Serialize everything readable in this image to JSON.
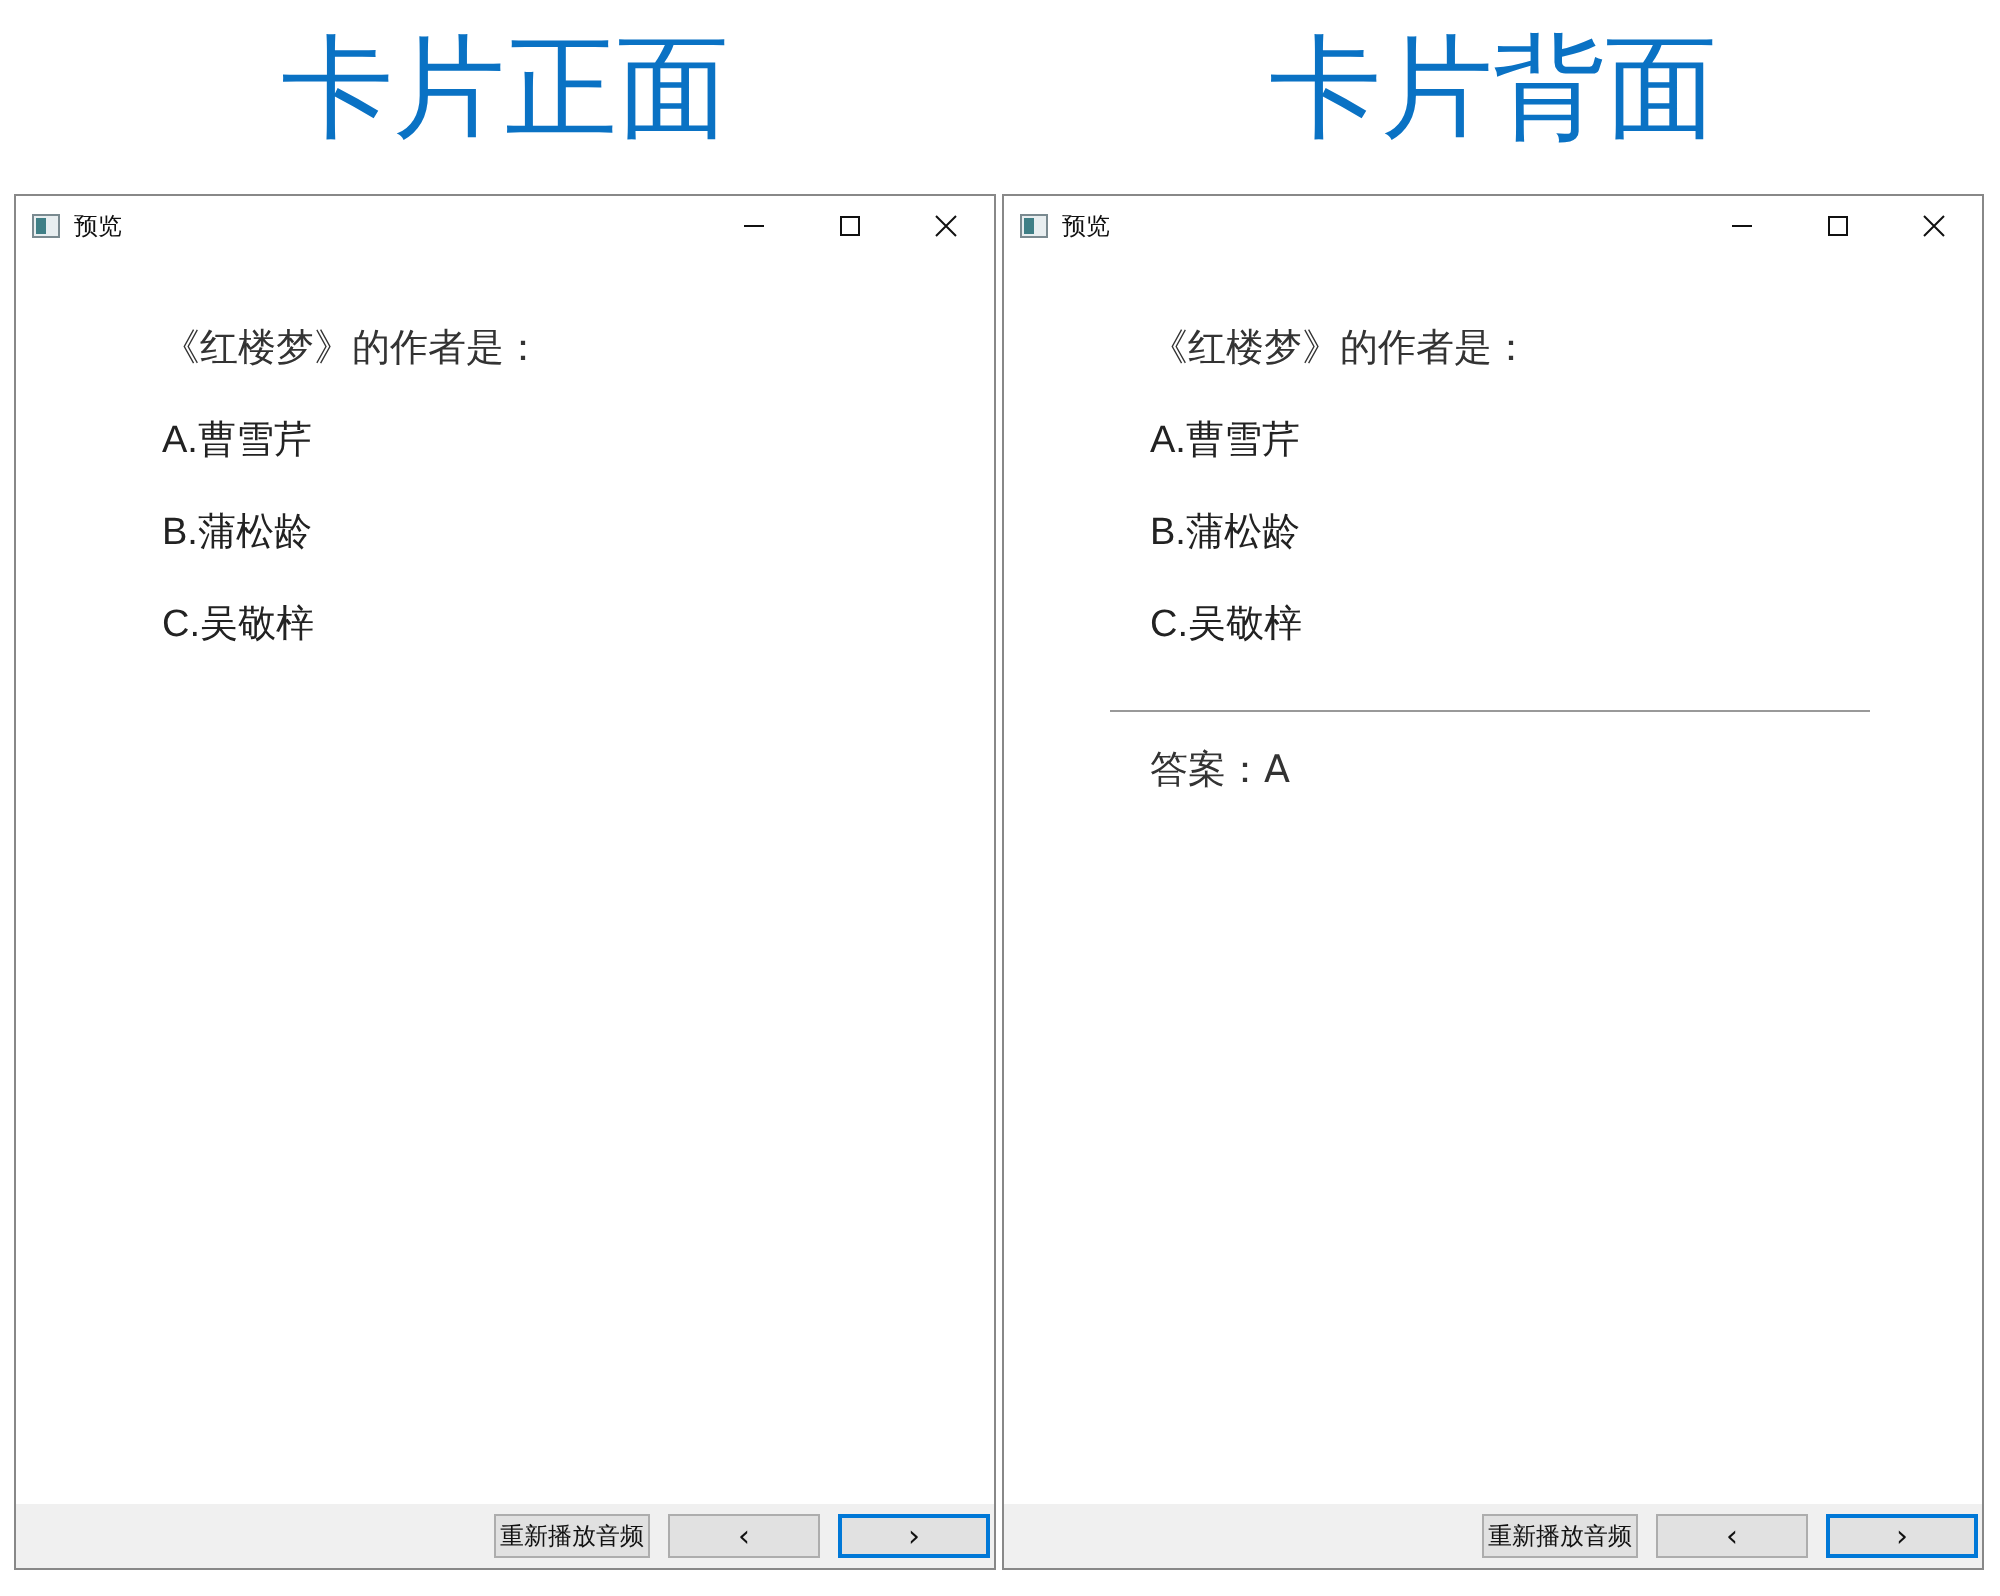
{
  "panels": [
    {
      "heading": "卡片正面",
      "window": {
        "title": "预览"
      },
      "question": "《红楼梦》的作者是：",
      "options": [
        "A.曹雪芹",
        "B.蒲松龄",
        "C.吴敬梓"
      ],
      "buttons": [
        {
          "kind": "text",
          "label": "重新播放音频",
          "focused": false
        },
        {
          "kind": "prev",
          "label": "‹",
          "focused": false
        },
        {
          "kind": "next",
          "label": "›",
          "focused": true
        }
      ]
    },
    {
      "heading": "卡片背面",
      "window": {
        "title": "预览"
      },
      "question": "《红楼梦》的作者是：",
      "options": [
        "A.曹雪芹",
        "B.蒲松龄",
        "C.吴敬梓"
      ],
      "answer": "答案：A",
      "buttons": [
        {
          "kind": "text",
          "label": "重新播放音频",
          "focused": false
        },
        {
          "kind": "prev",
          "label": "‹",
          "focused": false
        },
        {
          "kind": "next",
          "label": "›",
          "focused": true
        }
      ]
    }
  ]
}
